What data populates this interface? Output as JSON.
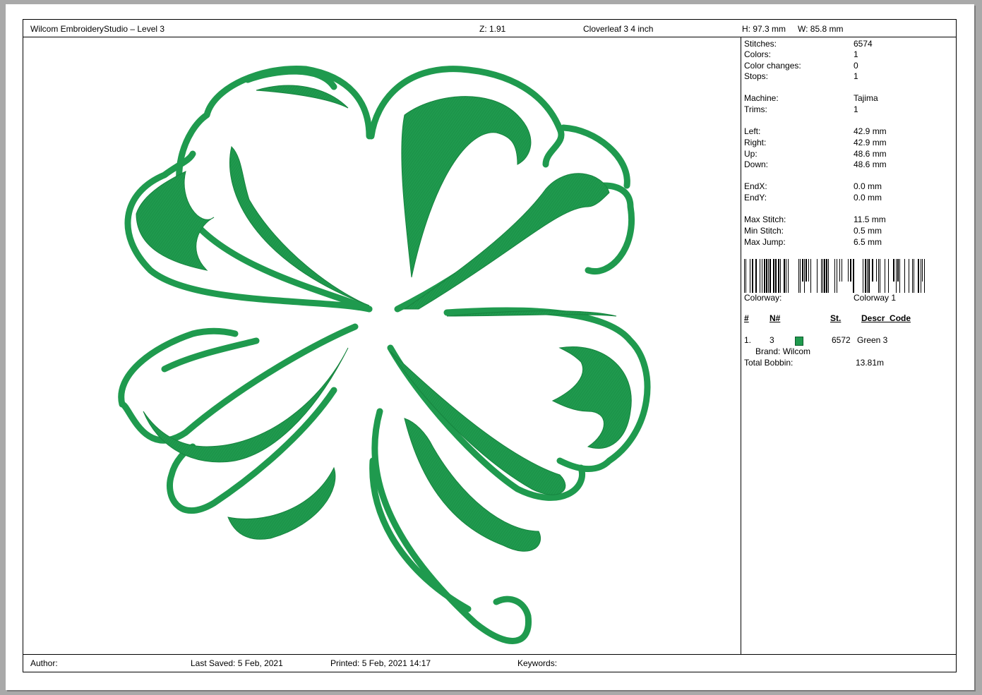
{
  "header": {
    "app_title": "Wilcom EmbroideryStudio – Level 3",
    "zoom": "Z: 1.91",
    "design_name": "Cloverleaf 3 4 inch",
    "height": "H: 97.3 mm",
    "width": "W: 85.8 mm"
  },
  "info": {
    "stitches_label": "Stitches:",
    "stitches": "6574",
    "colors_label": "Colors:",
    "colors": "1",
    "color_changes_label": "Color changes:",
    "color_changes": "0",
    "stops_label": "Stops:",
    "stops": "1",
    "machine_label": "Machine:",
    "machine": "Tajima",
    "trims_label": "Trims:",
    "trims": "1",
    "left_label": "Left:",
    "left": "42.9 mm",
    "right_label": "Right:",
    "right": "42.9 mm",
    "up_label": "Up:",
    "up": "48.6 mm",
    "down_label": "Down:",
    "down": "48.6 mm",
    "endx_label": "EndX:",
    "endx": "0.0 mm",
    "endy_label": "EndY:",
    "endy": "0.0 mm",
    "max_stitch_label": "Max Stitch:",
    "max_stitch": "11.5 mm",
    "min_stitch_label": "Min Stitch:",
    "min_stitch": "0.5 mm",
    "max_jump_label": "Max Jump:",
    "max_jump": "6.5 mm"
  },
  "colorway": {
    "label": "Colorway:",
    "value": "Colorway 1",
    "headers": {
      "num": "#",
      "n": "N#",
      "st": "St.",
      "descr": "Descr_Code"
    },
    "rows": [
      {
        "index": "1.",
        "n": "3",
        "color": "#1f9a4e",
        "stitches": "6572",
        "descr": "Green 3",
        "brand": "Brand: Wilcom"
      }
    ],
    "total_bobbin_label": "Total Bobbin:",
    "total_bobbin": "13.81m"
  },
  "footer": {
    "author_label": "Author:",
    "last_saved": "Last Saved:  5 Feb, 2021",
    "printed": "Printed:  5 Feb, 2021 14:17",
    "keywords_label": "Keywords:"
  },
  "design": {
    "thread_color": "#1f9a4e",
    "thread_shade": "#1a8a45"
  }
}
